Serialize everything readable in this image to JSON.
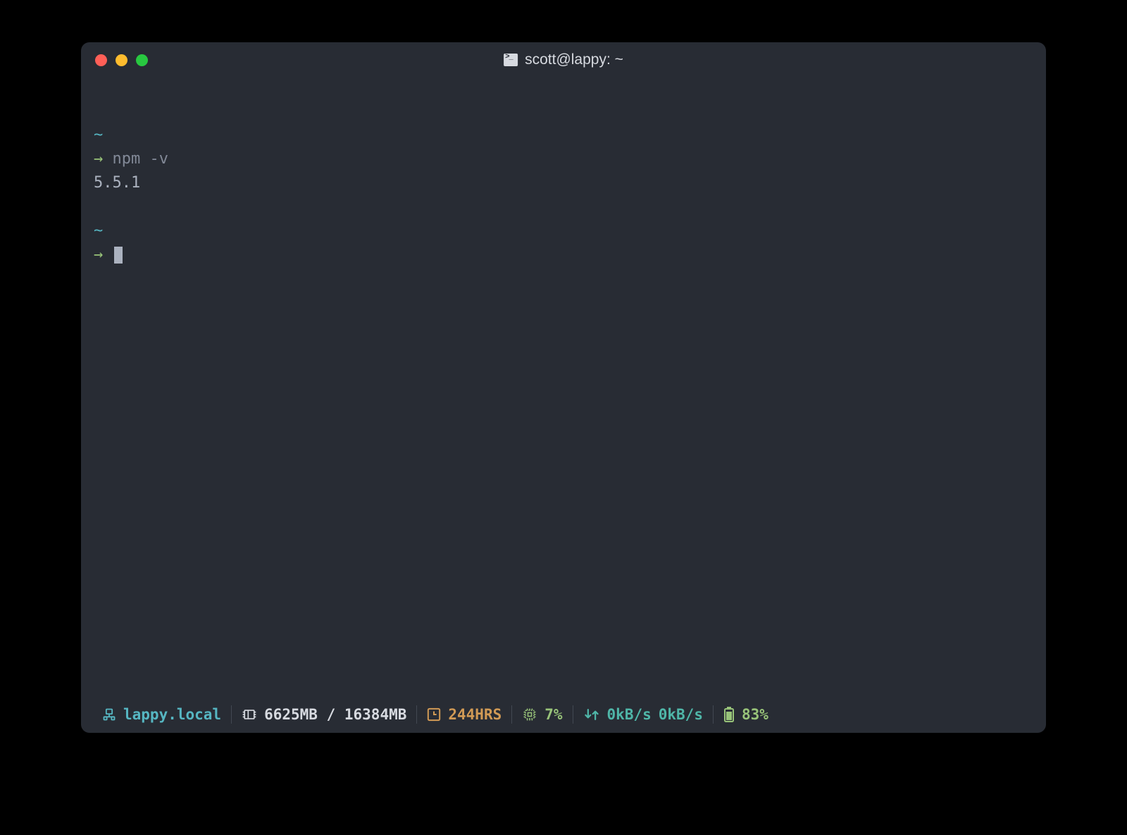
{
  "titlebar": {
    "title": "scott@lappy: ~"
  },
  "session": {
    "block1": {
      "path": "~",
      "arrow": "→",
      "command": "npm -v",
      "output": "5.5.1"
    },
    "block2": {
      "path": "~",
      "arrow": "→"
    }
  },
  "statusbar": {
    "host": "lappy.local",
    "memory": "6625MB / 16384MB",
    "uptime": "244HRS",
    "cpu": "7%",
    "net_down": "0kB/s",
    "net_up": "0kB/s",
    "battery": "83%"
  }
}
